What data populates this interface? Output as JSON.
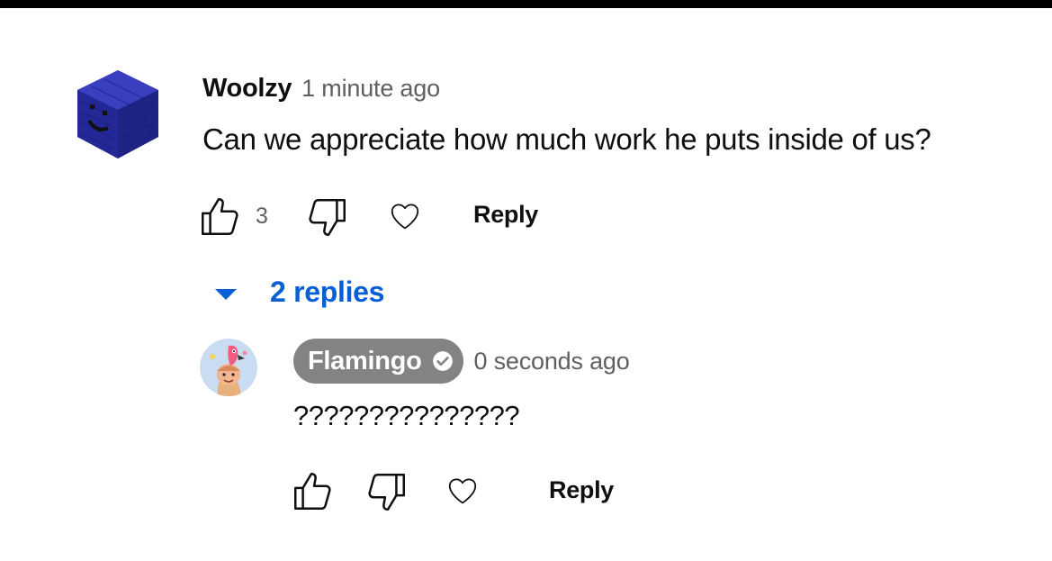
{
  "comment": {
    "author": "Woolzy",
    "time": "1 minute ago",
    "text": "Can we appreciate how much work he puts inside of us?",
    "avatar_icon": "blue-smiley-cube-avatar",
    "like_count": "3",
    "reply_label": "Reply",
    "icons": {
      "like": "thumbs-up-icon",
      "dislike": "thumbs-down-icon",
      "heart": "heart-icon"
    }
  },
  "replies_toggle": {
    "label": "2 replies",
    "icon": "caret-down-icon",
    "color": "#065fd4"
  },
  "reply": {
    "author": "Flamingo",
    "verified_icon": "verified-check-icon",
    "time": "0 seconds ago",
    "text": "???????????????",
    "avatar_icon": "flamingo-avatar",
    "reply_label": "Reply",
    "chip_color": "#838383"
  },
  "colors": {
    "text_primary": "#0f0f0f",
    "text_secondary": "#606060",
    "avatar_blue": "#2a2ea8"
  }
}
